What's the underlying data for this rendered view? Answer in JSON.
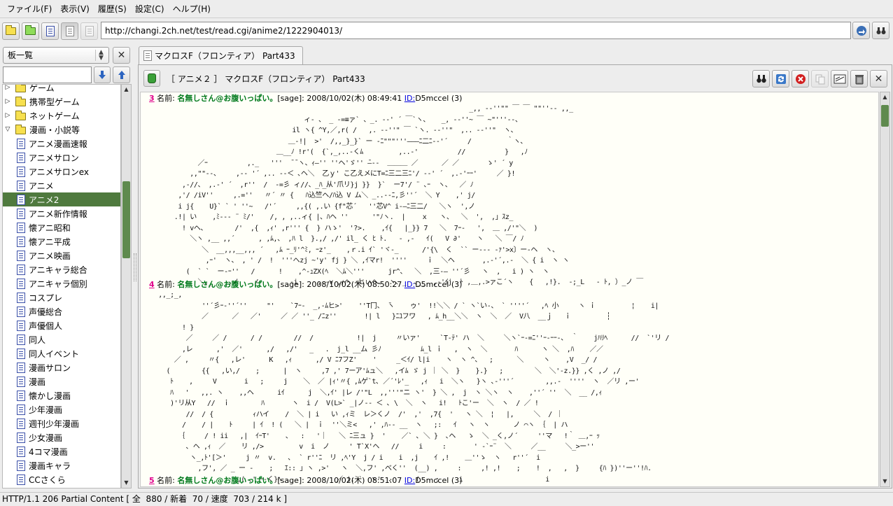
{
  "menu": [
    "ファイル(F)",
    "表示(V)",
    "履歴(S)",
    "設定(C)",
    "ヘルプ(H)"
  ],
  "url": "http://changi.2ch.net/test/read.cgi/anime2/1222904013/",
  "board_select": {
    "value": "板一覧"
  },
  "board_search": {
    "value": ""
  },
  "tree": [
    {
      "label": "ゲーム",
      "type": "folder",
      "depth": 0,
      "expanded": false
    },
    {
      "label": "携帯型ゲーム",
      "type": "folder",
      "depth": 0,
      "expanded": false
    },
    {
      "label": "ネットゲーム",
      "type": "folder",
      "depth": 0,
      "expanded": false
    },
    {
      "label": "漫画・小説等",
      "type": "folder",
      "depth": 0,
      "expanded": true
    },
    {
      "label": "アニメ漫画速報",
      "type": "board",
      "depth": 1
    },
    {
      "label": "アニメサロン",
      "type": "board",
      "depth": 1
    },
    {
      "label": "アニメサロンex",
      "type": "board",
      "depth": 1
    },
    {
      "label": "アニメ",
      "type": "board",
      "depth": 1
    },
    {
      "label": "アニメ2",
      "type": "board",
      "depth": 1,
      "selected": true
    },
    {
      "label": "アニメ新作情報",
      "type": "board",
      "depth": 1
    },
    {
      "label": "懐アニ昭和",
      "type": "board",
      "depth": 1
    },
    {
      "label": "懐アニ平成",
      "type": "board",
      "depth": 1
    },
    {
      "label": "アニメ映画",
      "type": "board",
      "depth": 1
    },
    {
      "label": "アニキャラ総合",
      "type": "board",
      "depth": 1
    },
    {
      "label": "アニキャラ個別",
      "type": "board",
      "depth": 1
    },
    {
      "label": "コスプレ",
      "type": "board",
      "depth": 1
    },
    {
      "label": "声優総合",
      "type": "board",
      "depth": 1
    },
    {
      "label": "声優個人",
      "type": "board",
      "depth": 1
    },
    {
      "label": "同人",
      "type": "board",
      "depth": 1
    },
    {
      "label": "同人イベント",
      "type": "board",
      "depth": 1
    },
    {
      "label": "漫画サロン",
      "type": "board",
      "depth": 1
    },
    {
      "label": "漫画",
      "type": "board",
      "depth": 1
    },
    {
      "label": "懐かし漫画",
      "type": "board",
      "depth": 1
    },
    {
      "label": "少年漫画",
      "type": "board",
      "depth": 1
    },
    {
      "label": "週刊少年漫画",
      "type": "board",
      "depth": 1
    },
    {
      "label": "少女漫画",
      "type": "board",
      "depth": 1
    },
    {
      "label": "4コマ漫画",
      "type": "board",
      "depth": 1
    },
    {
      "label": "漫画キャラ",
      "type": "board",
      "depth": 1
    },
    {
      "label": "CCさくら",
      "type": "board",
      "depth": 1
    }
  ],
  "tab": {
    "label": "マクロスF（フロンティア） Part433"
  },
  "thread": {
    "title": "［ アニメ２ ］ マクロスF（フロンティア） Part433"
  },
  "right_toolbar": [
    "search-icon",
    "reload-icon",
    "stop-icon",
    "copy-icon",
    "writing-icon",
    "trash-icon",
    "close-icon"
  ],
  "posts": [
    {
      "number": "3",
      "name_label": "名前:",
      "name": "名無しさん@お腹いっぱい。",
      "mail": "[sage]:",
      "date": "2008/10/02(木) 08:49:41",
      "id_label": "ID:",
      "id": "D5mccel",
      "id_count": "(3)",
      "aa": [
        "                                                                                 _,, -‐''\"\" ￣ ￣ \"\"''‐- ,,_",
        "                                       ィ- 、 _ -=≡ァ` 、_. -‐' ´ ￣`ヽ、   _, -‐''~ ￣ ~\"'''‐-、",
        "                                    il ヽ{ ^Y,／,r( /   ,. -‐''\" ￣ `ヽ. -‐''\"  ,.. -‐''\"  ヽ、",
        "                                   ＿-!|  >'  /,,_}_}` ー ‐ﾆ\"\"\"'''―――ﾆ二ﾆ-‐'´     /         ｀ヽ、",
        "                                ＿__ﾉ !r'(  {`,_,..‐くﾑ         ,..-'          //          }   ,ﾉ",
        "            ／ｰ          ,._   '''  ̄ ̄ ヽ、ｨ―'' ''ヘ'ゞ'' ̄―‐-  ＿＿＿ ／      ／ ／       ゝ' ´ y",
        "          ,,\"\"‐-、    ,-‐ '´ ,.. -‐＜ ､ヘ＼  乙ｙ' こ乙えメにT=ﾆ三二三ﾆ'/ -‐' ´  ,.-'ｰｰ'     ／ }!",
        "        ,-//、 ,.-' ´  ,r''  /  -=彡 ィ//、_ﾊ_从'爪リ}j }}  }`  ー7'/ ¨ ､ｰ  ヽ、  ／ ﾉ",
        "       ,'/ /iV''     ,.=''   〃´ 〃 {   ﾊ込竺ヘ/ﾊ込 V ム＼ _..-‐ﾆ,彡''´  ＼ Y    ,' j/",
        "       i j{    U}` ` ' ''~   /'´     ,,{( ,.い {f\"芯´   ''芯V^ i-―ﾆ三二/   ＼ヽ  ',ノ",
        "      .!| い    ,ﾐ-‐‐ ¨ ﾐ/'    /, , ,..ィ{ |、ﾊヘ ''      '\"ﾉヽ.  |    ｘ   ヽ、  ＼  ',  ,」ｽz_",
        "        ! vヘ、       /'  ,{  ,ｨ' ,r''' {  } ハゝ'  '?>.    ,ｲ{   |_}} 7   ＼  7ｰ-   ',  ＿ ,/'\"＼  )",
        "          ＼ヽ ,__ ,,´      , ,ﾑ,、 ,ﾊ l  }.,/ ,/' il_ く ﾋ ﾄ.   - ,-   ｲ(   V ∂'    ヽ   ＼ ￣/ ﾉ",
        "             ＼  __,,,__,,, ´   ,ﾑ ｰ_ﾘ'^ﾐ, ｰz'_    ,ｒ.i ｲ` 'ヾ-_      /'{\\  く  `` ー--‐ -ｧ'>x〕ー‐ヘ  ヽ、",
        "              ,ｰ'  ヽ、 , ' /  !  '''へzj ~'y' fj } ＼ ,ｲマr!  ''''     ｉ  ＼ヘ       ,.-'´,.-  ＼ { i  ヽ ヽ",
        "         (  ` `  ー-ｰ''   /      !    ,^-ｭZX(ﾍ  ＼ﾑ＼'''      jr^、  ＼  ,三‐― ''´彡   ヽ  ,   i ) ヽ  ヽ",
        "            ＼,_    ,ノ    /        -i     ,.-v ,ｨヘ ･ヒぃヘ、 ヽ、_  ､__  ,-'ｲj  ﾄ ,＿,.>ァこ´ヽ    {   ,!}.  -;_L   ‐ ﾄ, ）_ノ ￣"
      ]
    },
    {
      "number": "4",
      "name_label": "名前:",
      "name": "名無しさん@お腹いっぱい。",
      "mail": "[sage]:",
      "date": "2008/10/02(木) 08:50:27",
      "id_label": "ID:",
      "id": "D5mccel",
      "id_count": "(3)",
      "aa": [
        "  ,,_;_,",
        "             ''´彡ｰ-''´''     \"'    `7ｰ-  _,-ﾑヒ>'    ''T冂、 ̄ヽ    ゥ'  !!＼＼ / ` ヽ`い-、 ` ''''´   ,ﾍ 小     ヽ ｉ         ¦    i|",
        "             ／      ／   ／'     ／ ／ ''_ /ﾆz''       !| l   }ﾆﾕフワ   , ﾑ_h__＼＼  ヽ  ＼  ／  V八  __ｊ   ｉ         ┆",
        "        ! }",
        "         ／     ／ /      / /        //  /           !|  j     〃いァ'     `T-ﾃ' ハ  ＼     ＼ヽ`ｰ-=ﾆ''ｰ‐ｰｰ-、 ｀    jﾊﾘﾍ      //  `'リ /",
        "        ,レ      ,'  ／'      ,/   ,/'   _   .  j_l __ム 彡ﾉ          ﾑ_l ｉ   ,  ヽ  ＼       ﾊ      ヽ ＼  ,ﾊ    ／／",
        "      ／ ,     〃{   ,レ'      K   ,ｨ      ,/ V ﾆ7フZ'    '     _＜ｲ/ l|i    ヽ  ヽ ^、  ;      ＼     ヽ    ,V  _/ /",
        "    (        {{   ,い,/    ;      |  ヽ     ,7 ,' 7ーア'ﾑュ＼   ,イﾑ ゞ j ｜ ＼  }    }.}   ;        ＼  ＼'-z.}} ,く ,ノ ,/",
        "     ﾄ    ,     V       i   ;     j    ＼  ／ |ｨ'〃{ ,ﾑゲ`t､ ／´'ﾚ'_   ,ｨ   i  ＼ヽ   }ヽ ､‐'''´        ,,.-  ''''  ヽ  ／リ ,ー'",
        "     ﾊ   '   ,,. ヽ    ,,ヘ      iｲ      j  ＼,ｲ' |レ /'\"L  ,,'''\"ニ ヽ'  } ＼ ,  j  ヽ ＼ヽ  ヽ    ,''´ ''  ＼  __ /,ｨ",
        "     )'リ从Y   //  ｉ        ﾊ       ヽ  i /  V(L>` _|ノ-‐ ＜ ､ \\  ＼  ヽ   i!   ﾄこ'ー  ＼  ヽ  / ／ !",
        "         //  / {          ｨハイ    /  ＼ | i   い ,ｨミ  レ＞くノ  /'  ,'  ,7{  '   ヽ ＼  ¦   |,     ＼  / ｜",
        "        /    / |    ﾄ     | ｲ  ! (   ＼ |  ｉ  ''＼ミ<   ,' ,ﾊ-‐ __  ヽ   ;:   ｲ   ヽ  ヽ      ノ ⌒ヽ ｛  | ハ",
        "       ｛     / ! ii   ,|  ｲｰT'    ､   :   '｜   ＼ ﾆ三ュ }  '    ／` ､ ＼ }  ､ヘ   ゝ  ＼ _く,ノ´     ''マ   !｀ ＿,ｰ ｯ",
        "         ､ ヘ ,ｨ  ／    リ ,/>         v  i  ノ     ' T`X'ヘ   //     i     :       ' ‐`ｰ¨  ＼     ／__     ＼_>ー''",
        "          ヽ_,ﾄ'[＞'     j 〃  v.   ､  ` r''ﾆ  リ ,ﾍ'Y  j / i    i  ,j    ｲ ,!    ＿''ゝ  ヽ   r''´  i",
        "            ,フ', ／ _ ー ‐    ;   ｴ:: ｣ ヽ ,>'   ヽ  ＼,フ' ,べく''  (__) ,     :     ,! ,!    ;    !  ,   ,  }     {ﾊ })''ー''!ﾊ.",
        "                      ,( ､' ｰ‐く}ﾍ              ／ i:``  ヽ'  ､      (    ;     i                     i",
        "                                                                              /    ''  ー'"
      ]
    },
    {
      "number": "5",
      "name_label": "名前:",
      "name": "名無しさん@お腹いっぱい。",
      "mail": "[sage]:",
      "date": "2008/10/02(木) 08:51:07",
      "id_label": "ID:",
      "id": "D5mccel",
      "id_count": "(3)",
      "aa": []
    }
  ],
  "status": "HTTP/1.1 206 Partial Content [ 全  880 / 新着  70 / 速度  703 / 214 k ]",
  "colors": {
    "accent_green": "#4f7a3e",
    "post_number": "#e0008c",
    "post_name": "#00791c",
    "link": "#0000e0",
    "body_bg": "#fffff8"
  }
}
